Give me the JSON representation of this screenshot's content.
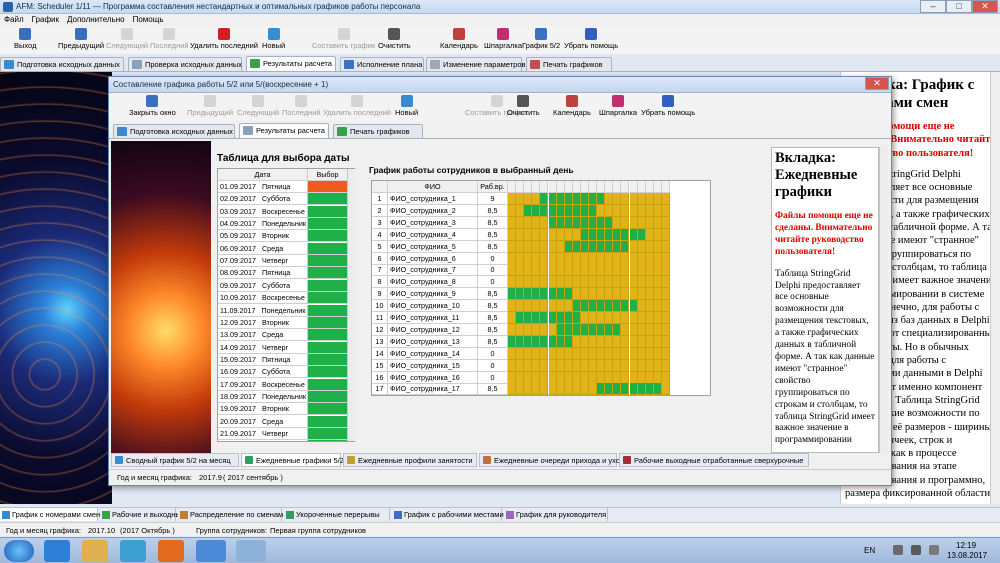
{
  "main_window": {
    "title": "AFM: Scheduler 1/11 — Программа составления  нестандартных и оптимальных графиков работы персонала",
    "menu": [
      "Файл",
      "График",
      "Дополнительно",
      "Помощь"
    ],
    "toolbar": [
      {
        "label": "Выход",
        "icon": "exit-icon",
        "color": "#3a6fc0",
        "enabled": true
      },
      {
        "label": "Предыдущий",
        "icon": "prev-icon",
        "color": "#3a6fc0",
        "enabled": true
      },
      {
        "label": "Следующий",
        "icon": "next-icon",
        "color": "#9a9a9a",
        "enabled": false
      },
      {
        "label": "Последний",
        "icon": "last-icon",
        "color": "#9a9a9a",
        "enabled": false
      },
      {
        "label": "Удалить последний",
        "icon": "delete-icon",
        "color": "#d02020",
        "enabled": true
      },
      {
        "label": "Новый",
        "icon": "new-icon",
        "color": "#3a8ad0",
        "enabled": true
      },
      {
        "label": "Составить график",
        "icon": "compose-icon",
        "color": "#9a9a9a",
        "enabled": false
      },
      {
        "label": "Очистить",
        "icon": "clear-icon",
        "color": "#555",
        "enabled": true
      },
      {
        "label": "Календарь",
        "icon": "calendar-icon",
        "color": "#c04040",
        "enabled": true
      },
      {
        "label": "Шпаргалка",
        "icon": "cheatsheet-icon",
        "color": "#c03070",
        "enabled": true
      },
      {
        "label": "График 5/2",
        "icon": "chart-icon",
        "color": "#3a70c0",
        "enabled": true
      },
      {
        "label": "Убрать помощь",
        "icon": "help-icon",
        "color": "#3060c0",
        "enabled": true
      }
    ],
    "tabs": [
      {
        "label": "Подготовка исходных данных",
        "active": false
      },
      {
        "label": "Проверка исходных данных",
        "active": false
      },
      {
        "label": "Результаты расчета",
        "active": true
      },
      {
        "label": "Исполнение плана",
        "active": false
      },
      {
        "label": "Изменение параметров",
        "active": false
      },
      {
        "label": "Печать графиков",
        "active": false
      }
    ],
    "bottom_tabs": [
      "График с номерами смен",
      "Рабочие и выходные",
      "Распределение по сменам",
      "Укороченные перерывы",
      "График с рабочими местами",
      "График для руководителя"
    ],
    "status_month_label": "Год и месяц графика:",
    "status_month_value": "2017.10",
    "status_month_text": "(2017  Октябрь )",
    "status_group_label": "Группа сотрудников:",
    "status_group_value": "Первая группа сотрудников"
  },
  "help_bg": {
    "title": "Вкладка: График с номерами смен",
    "warning": "Файлы помощи еще не сделаны. Внимательно читайте руководство пользователя!",
    "text": "Таблица StringGrid Delphi предоставляет все основные возможности для размещения текстовых, а также графических данных в табличной форме. А так как данные имеют \"странное\" свойство группироваться по строкам и столбцам, то таблица StringGrid имеет важное значение в программировании в системе Delphi. Конечно, для работы с данными из баз данных в Delphi существуют специализированные компоненты. Но в обычных условиях для работы с табличными данными в Delphi существует именно компонент StringGrid. Таблица StringGrid имеет гибкие возможности по настройке её размеров - ширины и высоты ячеек, строк и столбцов, как в процессе проектирования на этапе проектирования и программно, размера фиксированной области"
  },
  "dialog": {
    "title": "Составление графика работы 5/2 или 5/(воскресение + 1)",
    "toolbar": [
      {
        "label": "Закрыть окно",
        "icon": "close-window-icon",
        "color": "#3a6fc0",
        "enabled": true
      },
      {
        "label": "Предыдущий",
        "icon": "prev-icon",
        "color": "#9a9a9a",
        "enabled": false
      },
      {
        "label": "Следующий",
        "icon": "next-icon",
        "color": "#9a9a9a",
        "enabled": false
      },
      {
        "label": "Последний",
        "icon": "last-icon",
        "color": "#9a9a9a",
        "enabled": false
      },
      {
        "label": "Удалить последний",
        "icon": "delete-icon",
        "color": "#9a9a9a",
        "enabled": false
      },
      {
        "label": "Новый",
        "icon": "new-icon",
        "color": "#3a8ad0",
        "enabled": true
      },
      {
        "label": "Составить график",
        "icon": "compose-icon",
        "color": "#9a9a9a",
        "enabled": false
      },
      {
        "label": "Очистить",
        "icon": "clear-icon",
        "color": "#555",
        "enabled": true
      },
      {
        "label": "Календарь",
        "icon": "calendar-icon",
        "color": "#c04040",
        "enabled": true
      },
      {
        "label": "Шпаргалка",
        "icon": "cheatsheet-icon",
        "color": "#c03070",
        "enabled": true
      },
      {
        "label": "Убрать помощь",
        "icon": "help-icon",
        "color": "#3060c0",
        "enabled": true
      }
    ],
    "tabs": [
      {
        "label": "Подготовка исходных данных",
        "active": false
      },
      {
        "label": "Результаты расчета",
        "active": true
      },
      {
        "label": "Печать графиков",
        "active": false
      }
    ],
    "date_table_title": "Таблица для выбора даты",
    "date_headers": [
      "Дата",
      "Выбор"
    ],
    "dates": [
      [
        "01.09.2017",
        "Пятница",
        "selected"
      ],
      [
        "02.09.2017",
        "Суббота",
        "green"
      ],
      [
        "03.09.2017",
        "Воскресенье",
        "green"
      ],
      [
        "04.09.2017",
        "Понедельник",
        "green"
      ],
      [
        "05.09.2017",
        "Вторник",
        "green"
      ],
      [
        "06.09.2017",
        "Среда",
        "green"
      ],
      [
        "07.09.2017",
        "Четверг",
        "green"
      ],
      [
        "08.09.2017",
        "Пятница",
        "green"
      ],
      [
        "09.09.2017",
        "Суббота",
        "green"
      ],
      [
        "10.09.2017",
        "Воскресенье",
        "green"
      ],
      [
        "11.09.2017",
        "Понедельник",
        "green"
      ],
      [
        "12.09.2017",
        "Вторник",
        "green"
      ],
      [
        "13.09.2017",
        "Среда",
        "green"
      ],
      [
        "14.09.2017",
        "Четверг",
        "green"
      ],
      [
        "15.09.2017",
        "Пятница",
        "green"
      ],
      [
        "16.09.2017",
        "Суббота",
        "green"
      ],
      [
        "17.09.2017",
        "Воскресенье",
        "green"
      ],
      [
        "18.09.2017",
        "Понедельник",
        "green"
      ],
      [
        "19.09.2017",
        "Вторник",
        "green"
      ],
      [
        "20.09.2017",
        "Среда",
        "green"
      ],
      [
        "21.09.2017",
        "Четверг",
        "green"
      ],
      [
        "22.09.2017",
        "Пятница",
        "green"
      ]
    ],
    "schedule_title": "График работы сотрудников в выбранный день",
    "schedule_headers": [
      "ФИО",
      "Раб.вр."
    ],
    "employees": [
      {
        "n": "1",
        "name": "ФИО_сотрудника_1",
        "hours": "9",
        "g": [
          4,
          12
        ]
      },
      {
        "n": "2",
        "name": "ФИО_сотрудника_2",
        "hours": "8,5",
        "g": [
          2,
          11
        ]
      },
      {
        "n": "3",
        "name": "ФИО_сотрудника_3",
        "hours": "8,5",
        "g": [
          5,
          13
        ]
      },
      {
        "n": "4",
        "name": "ФИО_сотрудника_4",
        "hours": "8,5",
        "g": [
          9,
          17
        ]
      },
      {
        "n": "5",
        "name": "ФИО_сотрудника_5",
        "hours": "8,5",
        "g": [
          7,
          15
        ]
      },
      {
        "n": "6",
        "name": "ФИО_сотрудника_6",
        "hours": "0",
        "g": null
      },
      {
        "n": "7",
        "name": "ФИО_сотрудника_7",
        "hours": "0",
        "g": null
      },
      {
        "n": "8",
        "name": "ФИО_сотрудника_8",
        "hours": "0",
        "g": null
      },
      {
        "n": "9",
        "name": "ФИО_сотрудника_9",
        "hours": "8,5",
        "g": [
          0,
          8
        ]
      },
      {
        "n": "10",
        "name": "ФИО_сотрудника_10",
        "hours": "8,5",
        "g": [
          8,
          16
        ]
      },
      {
        "n": "11",
        "name": "ФИО_сотрудника_11",
        "hours": "8,5",
        "g": [
          1,
          9
        ]
      },
      {
        "n": "12",
        "name": "ФИО_сотрудника_12",
        "hours": "8,5",
        "g": [
          6,
          14
        ]
      },
      {
        "n": "13",
        "name": "ФИО_сотрудника_13",
        "hours": "8,5",
        "g": [
          0,
          8
        ]
      },
      {
        "n": "14",
        "name": "ФИО_сотрудника_14",
        "hours": "0",
        "g": null
      },
      {
        "n": "15",
        "name": "ФИО_сотрудника_15",
        "hours": "0",
        "g": null
      },
      {
        "n": "16",
        "name": "ФИО_сотрудника_16",
        "hours": "0",
        "g": null
      },
      {
        "n": "17",
        "name": "ФИО_сотрудника_17",
        "hours": "8,5",
        "g": [
          11,
          19
        ]
      }
    ],
    "help": {
      "title": "Вкладка: Ежедневные графики",
      "warning": "Файлы помощи еще не сделаны. Внимательно читайте руководство пользователя!",
      "text": "Таблица StringGrid Delphi предоставляет все основные возможности для размещения текстовых, а также графических данных в табличной форме. А так как данные имеют \"странное\" свойство группироваться по строкам и столбцам, то таблица StringGrid имеет важное значение в программировании"
    },
    "bottom_tabs": [
      "Сводный график 5/2 на месяц",
      "Ежедневные графики 5/2",
      "Ежедневные профили занятости",
      "Ежедневные очереди прихода и ухода",
      "Рабочие выходные отработанные сверхурочные"
    ],
    "status_label": "Год и месяц графика:",
    "status_value": "2017.9",
    "status_text": "( 2017  сентябрь )"
  },
  "taskbar": {
    "lang": "EN",
    "time": "12:19",
    "date": "13.08.2017"
  },
  "colors": {
    "selected": "#f05a1a",
    "green": "#20b04a",
    "yellow": "#e0b416"
  }
}
